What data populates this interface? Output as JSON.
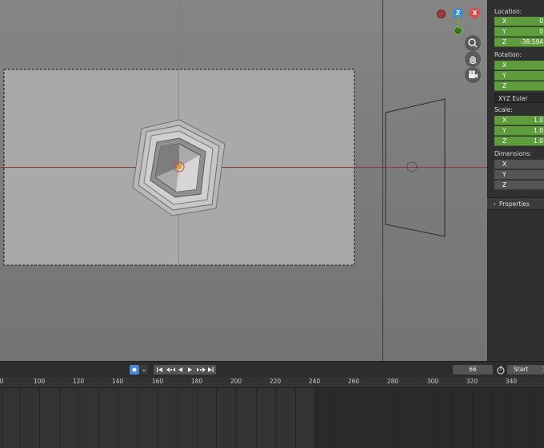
{
  "npanel": {
    "location_label": "Location:",
    "location": [
      {
        "axis": "X",
        "value": "0"
      },
      {
        "axis": "Y",
        "value": "0"
      },
      {
        "axis": "Z",
        "value": "-38.594"
      }
    ],
    "rotation_label": "Rotation:",
    "rotation": [
      {
        "axis": "X",
        "value": ""
      },
      {
        "axis": "Y",
        "value": ""
      },
      {
        "axis": "Z",
        "value": ""
      }
    ],
    "rotation_mode": "XYZ Euler",
    "scale_label": "Scale:",
    "scale": [
      {
        "axis": "X",
        "value": "1.0"
      },
      {
        "axis": "Y",
        "value": "1.0"
      },
      {
        "axis": "Z",
        "value": "1.0"
      }
    ],
    "dimensions_label": "Dimensions:",
    "dimensions": [
      {
        "axis": "X",
        "value": ""
      },
      {
        "axis": "Y",
        "value": ""
      },
      {
        "axis": "Z",
        "value": ""
      }
    ],
    "properties_label": "Properties"
  },
  "gizmo": {
    "z_label": "Z",
    "x_label": "X"
  },
  "timeline": {
    "current_frame": "66",
    "start_label": "Start",
    "start_value": "1",
    "ruler_labels": [
      "0",
      "100",
      "120",
      "140",
      "160",
      "180",
      "200",
      "220",
      "240",
      "260",
      "280",
      "300",
      "320",
      "340"
    ]
  },
  "colors": {
    "field_green": "#5e9c3e",
    "x_axis": "#e24a4a",
    "y_axis": "#6cad3a",
    "z_axis": "#3a8bd6",
    "keyframe_blue": "#4a86d8"
  }
}
